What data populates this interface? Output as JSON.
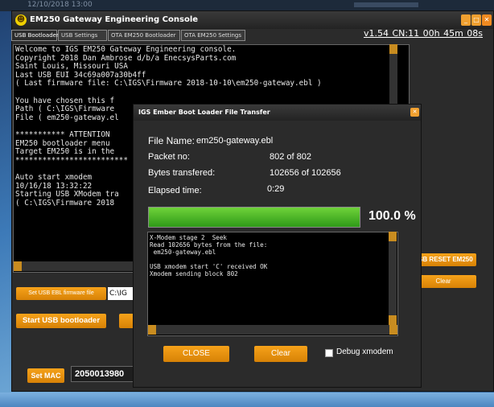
{
  "window": {
    "title": "EM250 Gateway Engineering Console",
    "desktop_text": "12/10/2018 13:00"
  },
  "tabs": [
    {
      "label": "USB Bootloader",
      "active": true
    },
    {
      "label": "USB Settings",
      "active": false
    },
    {
      "label": "OTA EM250 Bootloader",
      "active": false
    },
    {
      "label": "OTA EM250 Settings",
      "active": false
    }
  ],
  "status": "v1.54   CN:11   00h 45m 08s",
  "console": {
    "text": "Welcome to IGS EM250 Gateway Engineering console.\nCopyright 2018 Dan Ambrose d/b/a EnecsysParts.com\nSaint Louis, Missouri USA\nLast USB EUI 34c69a007a30b4ff\n( Last firmware file: C:\\IGS\\Firmware 2018-10-10\\em250-gateway.ebl )\n\nYou have chosen this f\nPath ( C:\\IGS\\Firmware\nFile ( em250-gateway.el\n\n*********** ATTENTION\nEM250 bootloader menu\nTarget EM250 is in the\n*************************\n\nAuto start xmodem\n10/16/18 13:32:22\nStarting USB XModem tra\n( C:\\IGS\\Firmware 2018"
  },
  "buttons": {
    "set_ebl": "Set USB EBL firmware file",
    "ebl_path": "C:\\IG",
    "start_bootloader": "Start USB bootloader",
    "reset_em250": "USB RESET EM250",
    "clear_main": "Clear",
    "set_mac": "Set MAC"
  },
  "mac_value": "2050013980",
  "dialog": {
    "title": "IGS Ember Boot Loader File Transfer",
    "file_name_label": "File Name:",
    "file_name": "em250-gateway.ebl",
    "packet_label": "Packet no:",
    "packet_value": "802  of  802",
    "bytes_label": "Bytes transfered:",
    "bytes_value": "102656  of  102656",
    "elapsed_label": "Elapsed time:",
    "elapsed_value": "0:29",
    "progress_fraction": 1.0,
    "progress_text": "100.0 %",
    "log_text": "X-Modem stage 2  Seek\nRead 102656 bytes from the file:\n em250-gateway.ebl\n\nUSB xmodem start 'C' received OK\nXmodem sending block 802",
    "close_label": "CLOSE",
    "clear_label": "Clear",
    "debug_label": "Debug xmodem",
    "debug_checked": false
  },
  "colors": {
    "accent_orange": "#f0a030",
    "progress_green": "#3fae20",
    "panel_bg": "#2b2b2b"
  }
}
